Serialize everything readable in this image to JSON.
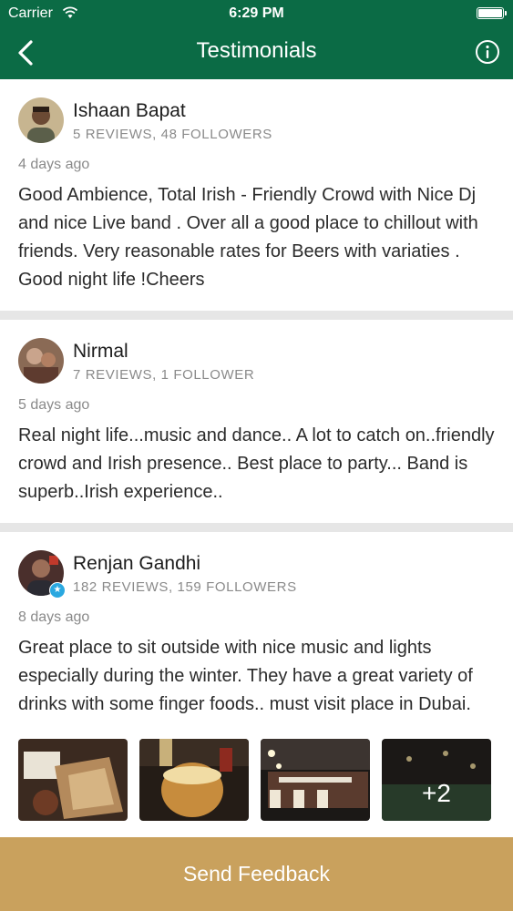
{
  "status_bar": {
    "carrier": "Carrier",
    "time": "6:29 PM"
  },
  "nav": {
    "title": "Testimonials",
    "back_icon": "chevron-left-icon",
    "info_icon": "info-icon"
  },
  "reviews": [
    {
      "name": "Ishaan Bapat",
      "stats": "5 REVIEWS, 48 FOLLOWERS",
      "date": "4 days ago",
      "text": "Good Ambience, Total Irish - Friendly Crowd with Nice Dj and nice Live band . Over all a good place to chillout with friends. Very reasonable rates for Beers with variaties . Good night life !Cheers"
    },
    {
      "name": "Nirmal",
      "stats": "7 REVIEWS, 1 FOLLOWER",
      "date": "5 days ago",
      "text": "Real night life...music and dance.. A lot to catch on..friendly crowd and Irish presence.. Best place to party... Band is superb..Irish experience.."
    },
    {
      "name": "Renjan Gandhi",
      "stats": "182 REVIEWS, 159 FOLLOWERS",
      "date": "8 days ago",
      "text": "Great place to sit outside with nice music and lights especially during the winter. They have a great variety of drinks with some finger foods.. must visit place in Dubai.",
      "more_photos": "+2"
    }
  ],
  "footer": {
    "label": "Send Feedback"
  },
  "colors": {
    "header": "#0b6b45",
    "footer": "#c9a15d",
    "divider": "#e6e6e6",
    "badge": "#2aa8e0"
  }
}
